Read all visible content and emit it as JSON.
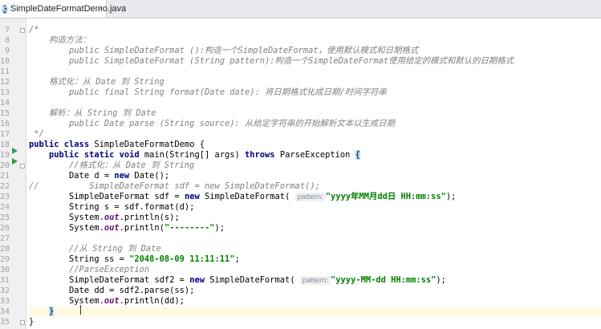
{
  "tab": {
    "icon": "class-icon",
    "icon_letter": "C",
    "label": "SimpleDateFormatDemo.java",
    "close": "×"
  },
  "line_numbers": [
    "7",
    "8",
    "9",
    "10",
    "11",
    "12",
    "13",
    "14",
    "15",
    "16",
    "17",
    "18",
    "19",
    "20",
    "21",
    "22",
    "23",
    "24",
    "25",
    "26",
    "27",
    "28",
    "29",
    "30",
    "31",
    "32",
    "33",
    "34",
    "35"
  ],
  "code": {
    "l7": "/*",
    "l8": "构造方法：",
    "l9_a": "public SimpleDateFormat ():",
    "l9_b": "构造一个",
    "l9_c": "SimpleDateFormat",
    "l9_d": "，使用默认模式和日期格式",
    "l10_a": "public SimpleDateFormat (String pattern):",
    "l10_b": "构造一个",
    "l10_c": "SimpleDateFormat",
    "l10_d": "使用给定的模式和默认的日期格式",
    "l12_a": "格式化：从 ",
    "l12_b": "Date",
    "l12_c": " 到 ",
    "l12_d": "String",
    "l13_a": "public final String format(Date date):",
    "l13_b": " 将日期格式化成日期/时间字符串",
    "l15_a": "解析：从 ",
    "l15_b": "String",
    "l15_c": " 到 ",
    "l15_d": "Date",
    "l16_a": "public Date parse (String source):",
    "l16_b": " 从给定字符串的开始解析文本以生成日期",
    "l17": " */",
    "l18_kw": "public class",
    "l18_rest": " SimpleDateFormatDemo {",
    "l19_kw1": "public static void",
    "l19_mid": " main(String[] args) ",
    "l19_kw2": "throws",
    "l19_rest": " ParseException ",
    "l19_brace": "{",
    "l20_a": "//格式化：从 ",
    "l20_b": "Date",
    "l20_c": " 到 ",
    "l20_d": "String",
    "l21_a": "Date d = ",
    "l21_kw": "new",
    "l21_b": " Date();",
    "l22_a": "//",
    "l22_b": "SimpleDateFormat sdf = new SimpleDateFormat();",
    "l23_a": "SimpleDateFormat sdf = ",
    "l23_kw": "new",
    "l23_b": " SimpleDateFormat( ",
    "l23_hint": "pattern:",
    "l23_str": "\"yyyy年MM月dd日 HH:mm:ss\"",
    "l23_end": ");",
    "l24": "String s = sdf.format(d);",
    "l25_a": "System.",
    "l25_fld": "out",
    "l25_b": ".println(s);",
    "l26_a": "System.",
    "l26_fld": "out",
    "l26_b": ".println(",
    "l26_str": "\"--------\"",
    "l26_end": ");",
    "l28_a": "//从 ",
    "l28_b": "String",
    "l28_c": " 到 ",
    "l28_d": "Date",
    "l29_a": "String ss = ",
    "l29_str": "\"2048-08-09 11:11:11\"",
    "l29_end": ";",
    "l30": "//ParseException",
    "l31_a": "SimpleDateFormat sdf2 = ",
    "l31_kw": "new",
    "l31_b": " SimpleDateFormat( ",
    "l31_hint": "pattern:",
    "l31_str": "\"yyyy-MM-dd HH:mm:ss\"",
    "l31_end": ");",
    "l32": "Date dd = sdf2.parse(ss);",
    "l33_a": "System.",
    "l33_fld": "out",
    "l33_b": ".println(dd);",
    "l34": "}",
    "l35": "}"
  },
  "colors": {
    "keyword": "#000080",
    "string": "#008000",
    "comment": "#808080",
    "field": "#660e7a",
    "run_marker": "#2d9b4a",
    "current_line": "#fffae3"
  }
}
